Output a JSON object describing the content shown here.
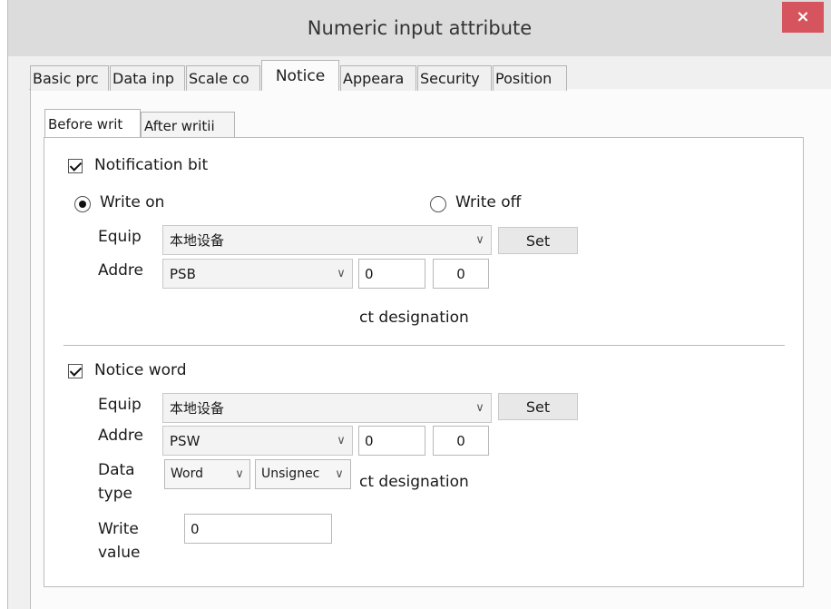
{
  "window": {
    "title": "Numeric input attribute",
    "close_glyph": "×"
  },
  "tabs": [
    "Basic prc",
    "Data inp",
    "Scale co",
    "Notice",
    "Appeara",
    "Security",
    "Position"
  ],
  "subtabs": [
    "Before writ",
    "After writii"
  ],
  "notification": {
    "checkbox_label": "Notification bit",
    "write_on_label": "Write on",
    "write_off_label": "Write off",
    "equip_label": "Equip",
    "equip_value": "本地设备",
    "set_label": "Set",
    "addr_label": "Addre",
    "addr_value": "PSB",
    "addr_num1": "0",
    "addr_num2": "0",
    "designation": "ct designation"
  },
  "notice_word": {
    "checkbox_label": "Notice word",
    "equip_label": "Equip",
    "equip_value": "本地设备",
    "set_label": "Set",
    "addr_label": "Addre",
    "addr_value": "PSW",
    "addr_num1": "0",
    "addr_num2": "0",
    "data_label_1": "Data",
    "data_label_2": "type",
    "data_type_value": "Word",
    "sign_value": "Unsignec",
    "designation": "ct designation",
    "write_label_1": "Write",
    "write_label_2": "value",
    "write_value": "0"
  }
}
